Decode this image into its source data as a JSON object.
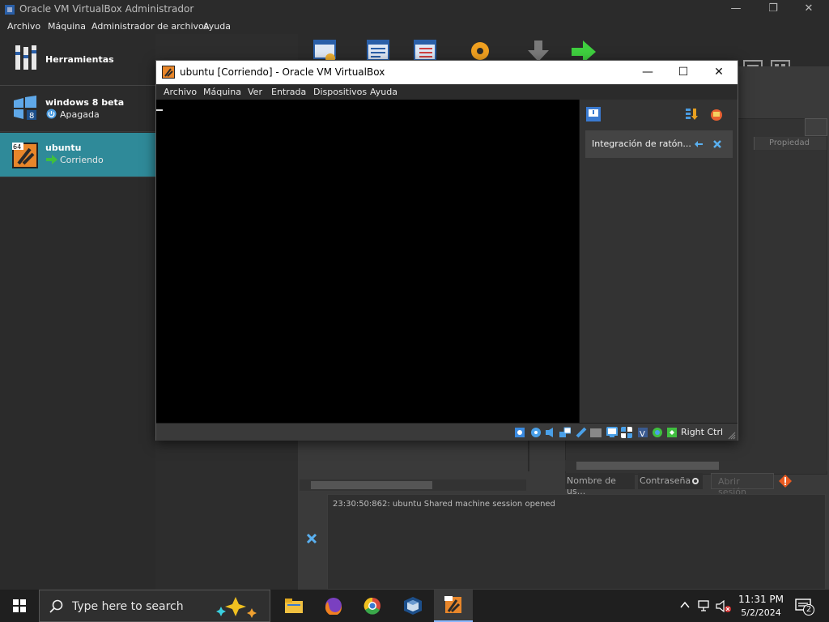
{
  "manager": {
    "title": "Oracle VM VirtualBox Administrador",
    "menu": [
      "Archivo",
      "Máquina",
      "Administrador de archivos",
      "Ayuda"
    ],
    "tools_label": "Herramientas",
    "vms": [
      {
        "name": "windows 8 beta",
        "state": "Apagada"
      },
      {
        "name": "ubuntu",
        "state": "Corriendo"
      }
    ],
    "properties_header": "Propiedad",
    "username_placeholder": "Nombre de us...",
    "password_placeholder": "Contraseña",
    "login_button": "Abrir sesión",
    "log_line": "23:30:50:862: ubuntu Shared machine session opened"
  },
  "vm_window": {
    "title": "ubuntu [Corriendo] - Oracle VM VirtualBox",
    "menu": [
      "Archivo",
      "Máquina",
      "Ver",
      "Entrada",
      "Dispositivos",
      "Ayuda"
    ],
    "notification": "Integración de ratón...",
    "host_key": "Right Ctrl"
  },
  "taskbar": {
    "search_placeholder": "Type here to search",
    "time": "11:31 PM",
    "date": "5/2/2024",
    "notification_count": "2"
  },
  "colors": {
    "selected_vm": "#2f8a99",
    "running_green": "#3fbf3f"
  }
}
